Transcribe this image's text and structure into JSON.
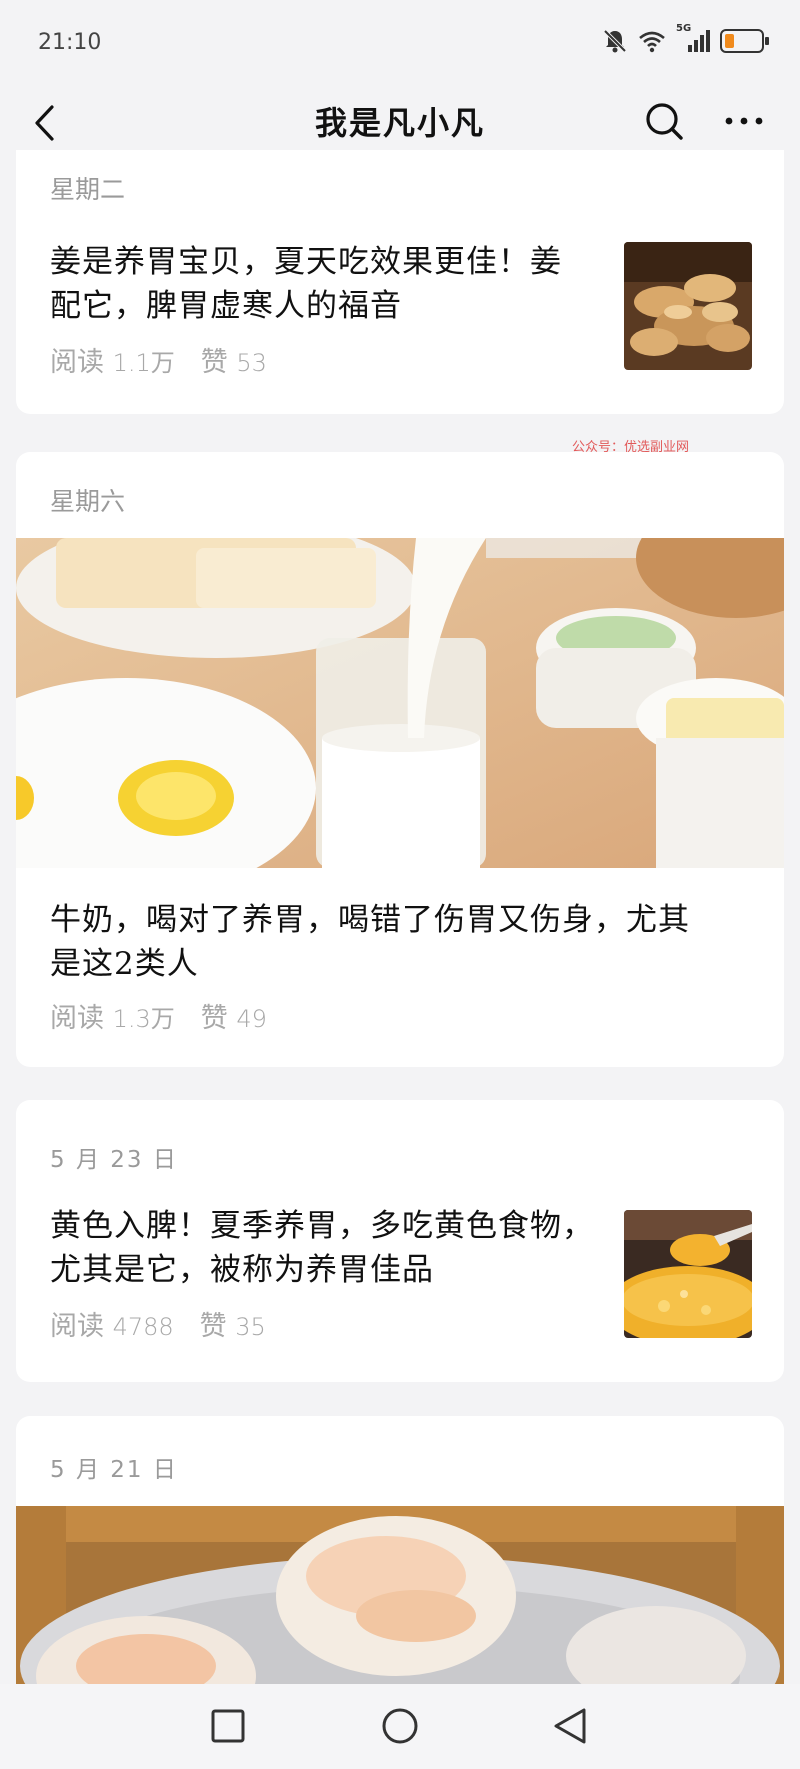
{
  "status_bar": {
    "time": "21:10",
    "network_label": "5G",
    "icons": [
      "bell-muted-icon",
      "wifi-icon",
      "signal-icon",
      "battery-icon"
    ],
    "battery_color": "#f08a1c"
  },
  "header": {
    "title": "我是凡小凡",
    "icons": [
      "back-arrow-icon",
      "search-icon",
      "more-icon"
    ]
  },
  "watermark": "公众号：优选副业网",
  "articles": [
    {
      "date": "星期二",
      "title_line1": "姜是养胃宝贝，夏天吃效果更佳！姜",
      "title_line2": "配它，脾胃虚寒人的福音",
      "reads_label": "阅读",
      "reads": "1.1万",
      "likes_label": "赞",
      "likes": "53",
      "image": "ginger-photo"
    },
    {
      "date": "星期六",
      "title_line1": "牛奶，喝对了养胃，喝错了伤胃又伤身，尤其",
      "title_line2": "是这2类人",
      "reads_label": "阅读",
      "reads": "1.3万",
      "likes_label": "赞",
      "likes": "49",
      "image": "milk-breakfast-photo"
    },
    {
      "date": "5 月 23 日",
      "title_line1": "黄色入脾！夏季养胃，多吃黄色食物，",
      "title_line2": "尤其是它，被称为养胃佳品",
      "reads_label": "阅读",
      "reads": "4788",
      "likes_label": "赞",
      "likes": "35",
      "image": "millet-porridge-photo"
    },
    {
      "date": "5 月 21 日",
      "image": "shrimp-dumpling-photo"
    }
  ],
  "nav_bar": {
    "icons": [
      "recent-apps-icon",
      "home-icon",
      "back-icon"
    ]
  }
}
